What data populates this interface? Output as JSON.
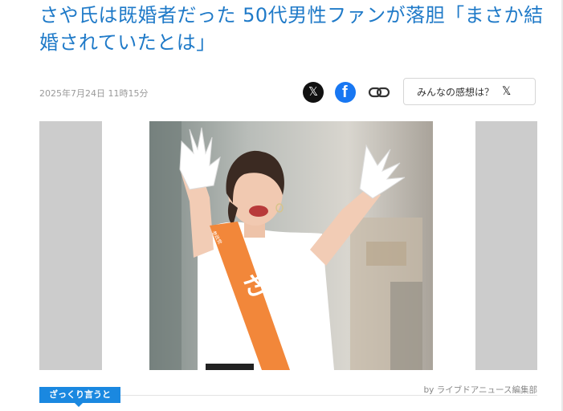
{
  "article": {
    "title": "さや氏は既婚者だった 50代男性ファンが落胆「まさか結婚されていたとは」",
    "date": "2025年7月24日 11時15分",
    "credit": "by ライブドアニュース編集部"
  },
  "share": {
    "x_icon": "x-logo-icon",
    "facebook_icon": "facebook-icon",
    "link_icon": "link-icon",
    "impressions_label": "みんなの感想は？",
    "impressions_icon": "x-logo-icon"
  },
  "photo": {
    "sash_text": "さや",
    "sash_small_text": "東京選挙区候補",
    "sash_badge": "参政党"
  },
  "tag": {
    "label": "ざっくり言うと"
  },
  "colors": {
    "title": "#1f7ac8",
    "accent": "#1a88e0",
    "sash": "#f2873a",
    "facebook": "#1877f2"
  }
}
